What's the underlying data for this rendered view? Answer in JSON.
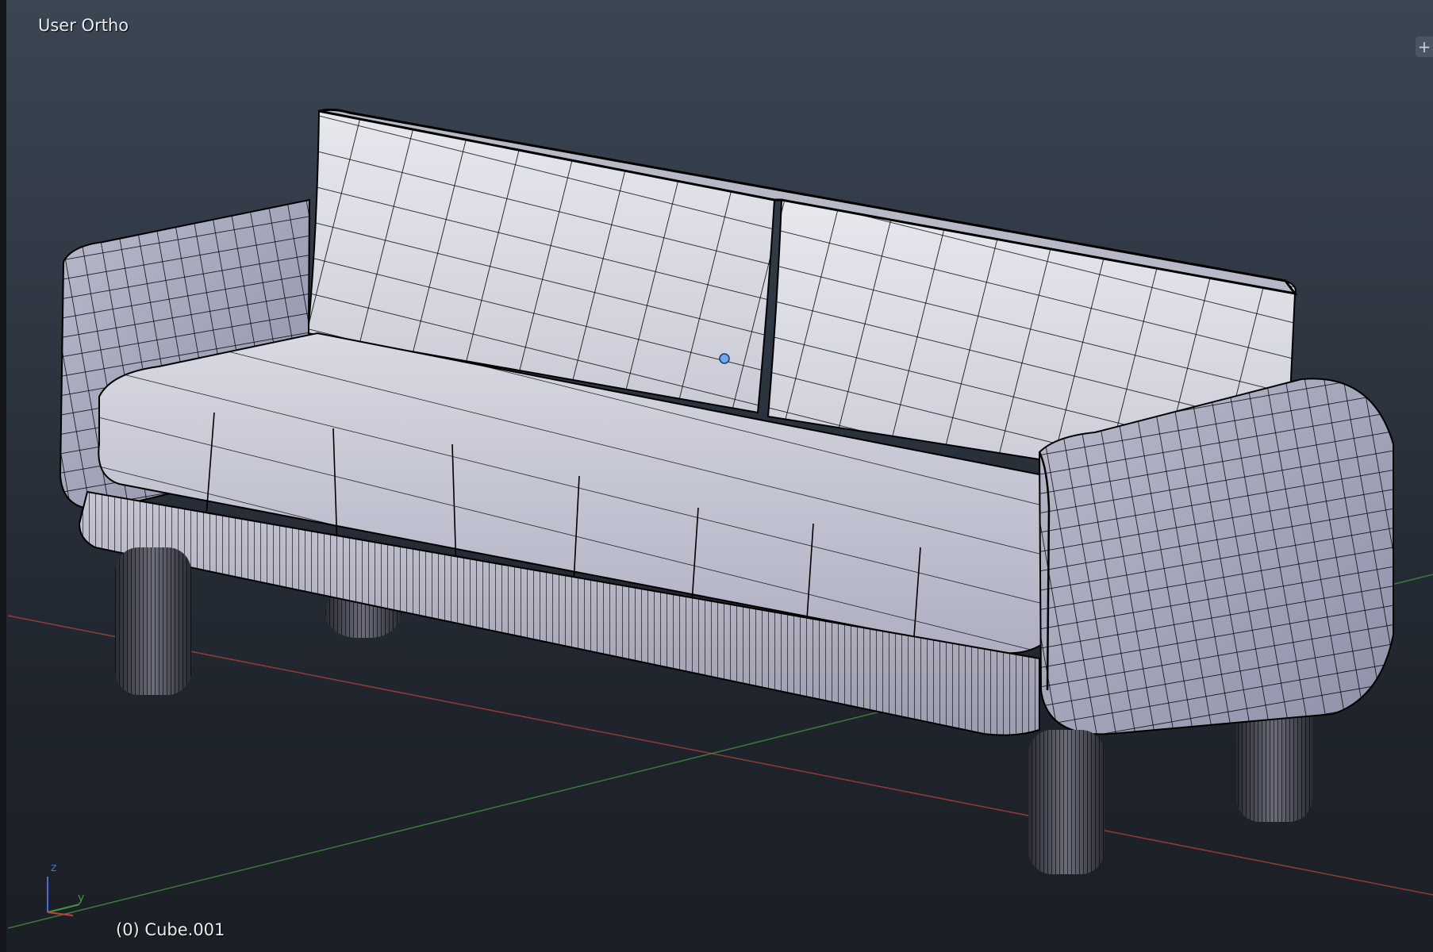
{
  "viewport": {
    "view_name": "User Ortho",
    "active_object": "(0) Cube.001",
    "toolshelf_toggle": "+"
  },
  "scene": {
    "object": "sofa",
    "display": "wireframe over solid shading",
    "colors": {
      "background_top": "#3b4653",
      "background_bottom": "#1b1f25",
      "mesh_surface": "#c9ccd6",
      "mesh_shadow": "#8d90a2",
      "wire": "#000000",
      "x_axis_line": "#b04040",
      "y_axis_line": "#3f8a3f",
      "origin_dot": "#6aa8e8"
    }
  },
  "gizmo": {
    "z_label": "z",
    "y_label": "y"
  }
}
